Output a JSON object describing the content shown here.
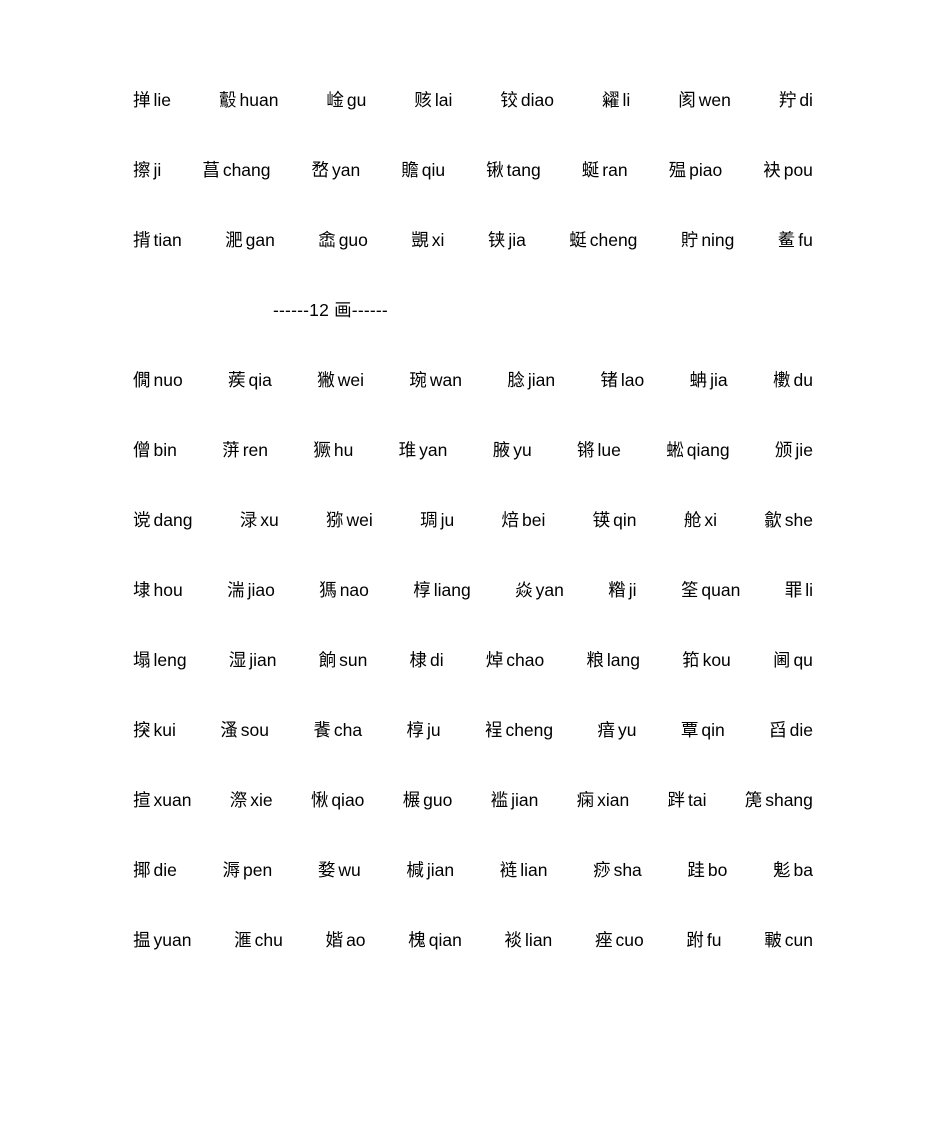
{
  "document": {
    "title": "汉字笔画表",
    "text_color": "#000000",
    "background_color": "#ffffff"
  },
  "sections": [
    {
      "name": "stroke-section-continued",
      "header": null,
      "rows": [
        {
          "name": "row-1",
          "entries": [
            {
              "han": "掸",
              "pinyin": "lie"
            },
            {
              "han": "鷇",
              "pinyin": "huan"
            },
            {
              "han": "崯",
              "pinyin": "gu"
            },
            {
              "han": "赅",
              "pinyin": "lai"
            },
            {
              "han": "铰",
              "pinyin": "diao"
            },
            {
              "han": "糴",
              "pinyin": "li"
            },
            {
              "han": "阂",
              "pinyin": "wen"
            },
            {
              "han": "羜",
              "pinyin": "di"
            }
          ]
        },
        {
          "name": "row-2",
          "entries": [
            {
              "han": "擦",
              "pinyin": "ji"
            },
            {
              "han": "菖",
              "pinyin": "chang"
            },
            {
              "han": "嵍",
              "pinyin": "yan"
            },
            {
              "han": "贍",
              "pinyin": "qiu"
            },
            {
              "han": "锹",
              "pinyin": "tang"
            },
            {
              "han": "蜒",
              "pinyin": "ran"
            },
            {
              "han": "殟",
              "pinyin": "piao"
            },
            {
              "han": "袂",
              "pinyin": "pou"
            }
          ]
        },
        {
          "name": "row-3",
          "entries": [
            {
              "han": "揹",
              "pinyin": "tian"
            },
            {
              "han": "淝",
              "pinyin": "gan"
            },
            {
              "han": "嵞",
              "pinyin": "guo"
            },
            {
              "han": "覬",
              "pinyin": "xi"
            },
            {
              "han": "铗",
              "pinyin": "jia"
            },
            {
              "han": "蜓",
              "pinyin": "cheng"
            },
            {
              "han": "貯",
              "pinyin": "ning"
            },
            {
              "han": "鲝",
              "pinyin": "fu"
            }
          ]
        }
      ]
    },
    {
      "name": "stroke-section-12",
      "header": "------12 画------",
      "rows": [
        {
          "name": "row-4",
          "entries": [
            {
              "han": "僩",
              "pinyin": "nuo"
            },
            {
              "han": "蒺",
              "pinyin": "qia"
            },
            {
              "han": "獙",
              "pinyin": "wei"
            },
            {
              "han": "琬",
              "pinyin": "wan"
            },
            {
              "han": "腍",
              "pinyin": "jian"
            },
            {
              "han": "锗",
              "pinyin": "lao"
            },
            {
              "han": "蚺",
              "pinyin": "jia"
            },
            {
              "han": "櫢",
              "pinyin": "du"
            }
          ]
        },
        {
          "name": "row-5",
          "entries": [
            {
              "han": "僧",
              "pinyin": "bin"
            },
            {
              "han": "蓱",
              "pinyin": "ren"
            },
            {
              "han": "獗",
              "pinyin": "hu"
            },
            {
              "han": "琟",
              "pinyin": "yan"
            },
            {
              "han": "腋",
              "pinyin": "yu"
            },
            {
              "han": "锵",
              "pinyin": "lue"
            },
            {
              "han": "蜙",
              "pinyin": "qiang"
            },
            {
              "han": "颁",
              "pinyin": "jie"
            }
          ]
        },
        {
          "name": "row-6",
          "entries": [
            {
              "han": "谠",
              "pinyin": "dang"
            },
            {
              "han": "渌",
              "pinyin": "xu"
            },
            {
              "han": "猕",
              "pinyin": "wei"
            },
            {
              "han": "琱",
              "pinyin": "ju"
            },
            {
              "han": "焙",
              "pinyin": "bei"
            },
            {
              "han": "锳",
              "pinyin": "qin"
            },
            {
              "han": "舱",
              "pinyin": "xi"
            },
            {
              "han": "歙",
              "pinyin": "she"
            }
          ]
        },
        {
          "name": "row-7",
          "entries": [
            {
              "han": "埭",
              "pinyin": "hou"
            },
            {
              "han": "湍",
              "pinyin": "jiao"
            },
            {
              "han": "獁",
              "pinyin": "nao"
            },
            {
              "han": "椁",
              "pinyin": "liang"
            },
            {
              "han": "焱",
              "pinyin": "yan"
            },
            {
              "han": "糌",
              "pinyin": "ji"
            },
            {
              "han": "筌",
              "pinyin": "quan"
            },
            {
              "han": "罪",
              "pinyin": "li"
            }
          ]
        },
        {
          "name": "row-8",
          "entries": [
            {
              "han": "塌",
              "pinyin": "leng"
            },
            {
              "han": "湿",
              "pinyin": "jian"
            },
            {
              "han": "餉",
              "pinyin": "sun"
            },
            {
              "han": "棣",
              "pinyin": "di"
            },
            {
              "han": "焯",
              "pinyin": "chao"
            },
            {
              "han": "粮",
              "pinyin": "lang"
            },
            {
              "han": "筘",
              "pinyin": "kou"
            },
            {
              "han": "阃",
              "pinyin": "qu"
            }
          ]
        },
        {
          "name": "row-9",
          "entries": [
            {
              "han": "揬",
              "pinyin": "kui"
            },
            {
              "han": "溞",
              "pinyin": "sou"
            },
            {
              "han": "餥",
              "pinyin": "cha"
            },
            {
              "han": "椁",
              "pinyin": "ju"
            },
            {
              "han": "裎",
              "pinyin": "cheng"
            },
            {
              "han": "瘖",
              "pinyin": "yu"
            },
            {
              "han": "覃",
              "pinyin": "qin"
            },
            {
              "han": "舀",
              "pinyin": "die"
            }
          ]
        },
        {
          "name": "row-10",
          "entries": [
            {
              "han": "揎",
              "pinyin": "xuan"
            },
            {
              "han": "漈",
              "pinyin": "xie"
            },
            {
              "han": "愀",
              "pinyin": "qiao"
            },
            {
              "han": "榐",
              "pinyin": "guo"
            },
            {
              "han": "褴",
              "pinyin": "jian"
            },
            {
              "han": "痫",
              "pinyin": "xian"
            },
            {
              "han": "跘",
              "pinyin": "tai"
            },
            {
              "han": "箎",
              "pinyin": "shang"
            }
          ]
        },
        {
          "name": "row-11",
          "entries": [
            {
              "han": "揶",
              "pinyin": "die"
            },
            {
              "han": "溽",
              "pinyin": "pen"
            },
            {
              "han": "婺",
              "pinyin": "wu"
            },
            {
              "han": "椷",
              "pinyin": "jian"
            },
            {
              "han": "裢",
              "pinyin": "lian"
            },
            {
              "han": "痧",
              "pinyin": "sha"
            },
            {
              "han": "跬",
              "pinyin": "bo"
            },
            {
              "han": "鬽",
              "pinyin": "ba"
            }
          ]
        },
        {
          "name": "row-12",
          "entries": [
            {
              "han": "揾",
              "pinyin": "yuan"
            },
            {
              "han": "滙",
              "pinyin": "chu"
            },
            {
              "han": "媘",
              "pinyin": "ao"
            },
            {
              "han": "槐",
              "pinyin": "qian"
            },
            {
              "han": "裧",
              "pinyin": "lian"
            },
            {
              "han": "痤",
              "pinyin": "cuo"
            },
            {
              "han": "跗",
              "pinyin": "fu"
            },
            {
              "han": "皸",
              "pinyin": "cun"
            }
          ]
        }
      ]
    }
  ]
}
